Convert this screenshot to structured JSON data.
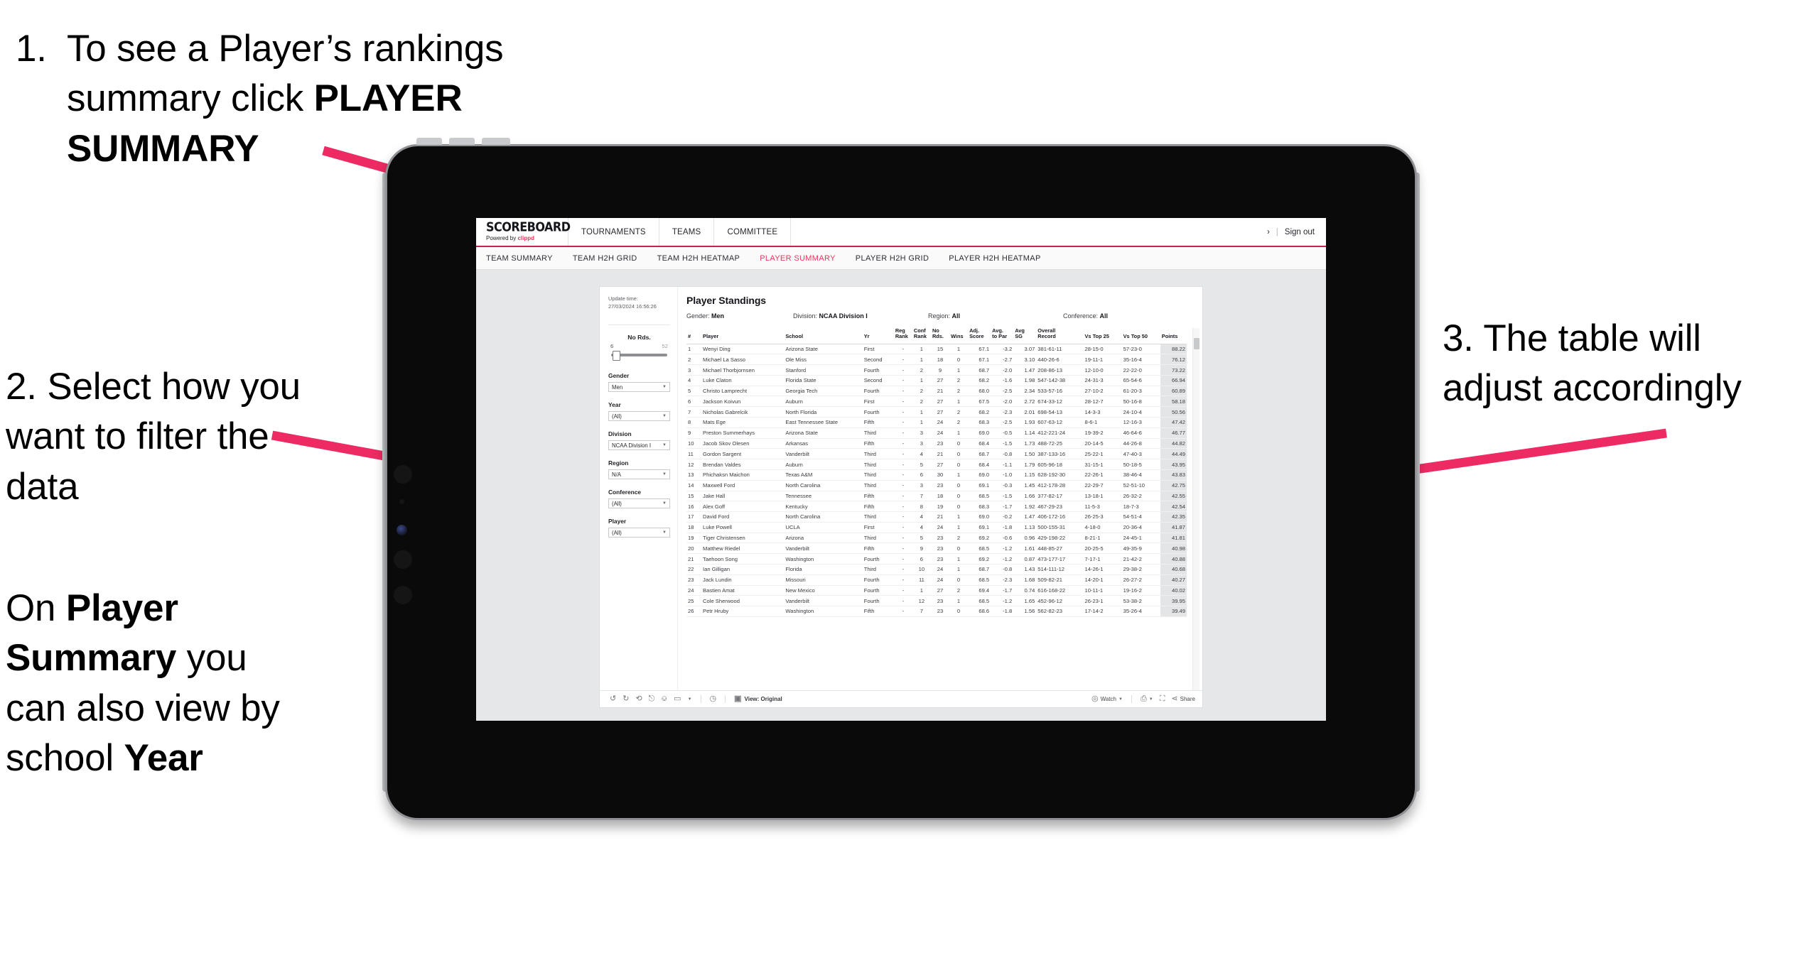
{
  "slide": {
    "callouts": [
      {
        "id": "callout-1",
        "number": "1.",
        "line1_plain": "To see a Player’s",
        "line2_plain": "summary click ",
        "line2_bold": "PLAYER",
        "line3_bold": "SUMMARY"
      },
      {
        "id": "callout-2",
        "text": "2. Select how you want to filter the data"
      },
      {
        "id": "callout-2b",
        "part1": "On ",
        "bold1": "Player Summary",
        "part2": " you can also view by school ",
        "bold2": "Year"
      },
      {
        "id": "callout-3",
        "text": "3. The table will adjust accordingly"
      }
    ],
    "arrow_color": "#ED2B62"
  },
  "app": {
    "brand": {
      "title": "SCOREBOARD",
      "powered_prefix": "Powered by ",
      "powered_name": "clippd"
    },
    "topnav": [
      "TOURNAMENTS",
      "TEAMS",
      "COMMITTEE"
    ],
    "topbar_right": {
      "user_glyph": "›",
      "divider": "|",
      "sign_out": "Sign out"
    },
    "subnav": {
      "items": [
        "TEAM SUMMARY",
        "TEAM H2H GRID",
        "TEAM H2H HEATMAP",
        "PLAYER SUMMARY",
        "PLAYER H2H GRID",
        "PLAYER H2H HEATMAP"
      ],
      "active_index": 3,
      "active_color": "#E8365D"
    },
    "filters": {
      "update_time_label": "Update time:",
      "update_time_value": "27/03/2024 16:56:26",
      "slider": {
        "label": "No Rds.",
        "min": "6",
        "max": "52",
        "thumb_percent": 2
      },
      "selects": [
        {
          "label": "Gender",
          "value": "Men"
        },
        {
          "label": "Year",
          "value": "(All)"
        },
        {
          "label": "Division",
          "value": "NCAA Division I"
        },
        {
          "label": "Region",
          "value": "N/A"
        },
        {
          "label": "Conference",
          "value": "(All)"
        },
        {
          "label": "Player",
          "value": "(All)"
        }
      ]
    },
    "table": {
      "title": "Player Standings",
      "summary": [
        {
          "label": "Gender: ",
          "value": "Men"
        },
        {
          "label": "Division: ",
          "value": "NCAA Division I"
        },
        {
          "label": "Region: ",
          "value": "All"
        },
        {
          "label": "Conference: ",
          "value": "All"
        }
      ],
      "columns": [
        "#",
        "Player",
        "School",
        "Yr",
        "Reg Rank",
        "Conf Rank",
        "No Rds.",
        "Wins",
        "Adj. Score",
        "Avg. to Par",
        "Avg SG",
        "Overall Record",
        "Vs Top 25",
        "Vs Top 50",
        "Points"
      ],
      "columns_wrapped": [
        [
          "#"
        ],
        [
          "Player"
        ],
        [
          "School"
        ],
        [
          "Yr"
        ],
        [
          "Reg",
          "Rank"
        ],
        [
          "Conf",
          "Rank"
        ],
        [
          "No",
          "Rds."
        ],
        [
          "Wins"
        ],
        [
          "Adj.",
          "Score"
        ],
        [
          "Avg.",
          "to Par"
        ],
        [
          "Avg",
          "SG"
        ],
        [
          "Overall",
          "Record"
        ],
        [
          "Vs Top 25"
        ],
        [
          "Vs Top 50"
        ],
        [
          "Points"
        ]
      ],
      "rows": [
        [
          "1",
          "Wenyi Ding",
          "Arizona State",
          "First",
          "-",
          "1",
          "15",
          "1",
          "67.1",
          "-3.2",
          "3.07",
          "381-61-11",
          "28-15-0",
          "57-23-0",
          "88.22"
        ],
        [
          "2",
          "Michael La Sasso",
          "Ole Miss",
          "Second",
          "-",
          "1",
          "18",
          "0",
          "67.1",
          "-2.7",
          "3.10",
          "440-26-6",
          "19-11-1",
          "35-16-4",
          "76.12"
        ],
        [
          "3",
          "Michael Thorbjornsen",
          "Stanford",
          "Fourth",
          "-",
          "2",
          "9",
          "1",
          "68.7",
          "-2.0",
          "1.47",
          "208-86-13",
          "12-10-0",
          "22-22-0",
          "73.22"
        ],
        [
          "4",
          "Luke Claton",
          "Florida State",
          "Second",
          "-",
          "1",
          "27",
          "2",
          "68.2",
          "-1.6",
          "1.98",
          "547-142-38",
          "24-31-3",
          "65-54-6",
          "66.94"
        ],
        [
          "5",
          "Christo Lamprecht",
          "Georgia Tech",
          "Fourth",
          "-",
          "2",
          "21",
          "2",
          "68.0",
          "-2.5",
          "2.34",
          "533-57-16",
          "27-10-2",
          "61-20-3",
          "60.89"
        ],
        [
          "6",
          "Jackson Koivun",
          "Auburn",
          "First",
          "-",
          "2",
          "27",
          "1",
          "67.5",
          "-2.0",
          "2.72",
          "674-33-12",
          "28-12-7",
          "50-16-8",
          "58.18"
        ],
        [
          "7",
          "Nicholas Gabrelcik",
          "North Florida",
          "Fourth",
          "-",
          "1",
          "27",
          "2",
          "68.2",
          "-2.3",
          "2.01",
          "698-54-13",
          "14-3-3",
          "24-10-4",
          "50.56"
        ],
        [
          "8",
          "Mats Ege",
          "East Tennessee State",
          "Fifth",
          "-",
          "1",
          "24",
          "2",
          "68.3",
          "-2.5",
          "1.93",
          "607-63-12",
          "8-6-1",
          "12-16-3",
          "47.42"
        ],
        [
          "9",
          "Preston Summerhays",
          "Arizona State",
          "Third",
          "-",
          "3",
          "24",
          "1",
          "69.0",
          "-0.5",
          "1.14",
          "412-221-24",
          "19-39-2",
          "46-64-6",
          "46.77"
        ],
        [
          "10",
          "Jacob Skov Olesen",
          "Arkansas",
          "Fifth",
          "-",
          "3",
          "23",
          "0",
          "68.4",
          "-1.5",
          "1.73",
          "488-72-25",
          "20-14-5",
          "44-26-8",
          "44.82"
        ],
        [
          "11",
          "Gordon Sargent",
          "Vanderbilt",
          "Third",
          "-",
          "4",
          "21",
          "0",
          "68.7",
          "-0.8",
          "1.50",
          "387-133-16",
          "25-22-1",
          "47-40-3",
          "44.49"
        ],
        [
          "12",
          "Brendan Valdes",
          "Auburn",
          "Third",
          "-",
          "5",
          "27",
          "0",
          "68.4",
          "-1.1",
          "1.79",
          "605-96-18",
          "31-15-1",
          "50-18-5",
          "43.95"
        ],
        [
          "13",
          "Phichaksn Maichon",
          "Texas A&M",
          "Third",
          "-",
          "6",
          "30",
          "1",
          "69.0",
          "-1.0",
          "1.15",
          "628-192-30",
          "22-26-1",
          "38-46-4",
          "43.83"
        ],
        [
          "14",
          "Maxwell Ford",
          "North Carolina",
          "Third",
          "-",
          "3",
          "23",
          "0",
          "69.1",
          "-0.3",
          "1.45",
          "412-178-28",
          "22-29-7",
          "52-51-10",
          "42.75"
        ],
        [
          "15",
          "Jake Hall",
          "Tennessee",
          "Fifth",
          "-",
          "7",
          "18",
          "0",
          "68.5",
          "-1.5",
          "1.66",
          "377-82-17",
          "13-18-1",
          "26-32-2",
          "42.55"
        ],
        [
          "16",
          "Alex Goff",
          "Kentucky",
          "Fifth",
          "-",
          "8",
          "19",
          "0",
          "68.3",
          "-1.7",
          "1.92",
          "467-29-23",
          "11-5-3",
          "18-7-3",
          "42.54"
        ],
        [
          "17",
          "David Ford",
          "North Carolina",
          "Third",
          "-",
          "4",
          "21",
          "1",
          "69.0",
          "-0.2",
          "1.47",
          "406-172-16",
          "26-25-3",
          "54-51-4",
          "42.35"
        ],
        [
          "18",
          "Luke Powell",
          "UCLA",
          "First",
          "-",
          "4",
          "24",
          "1",
          "69.1",
          "-1.8",
          "1.13",
          "500-155-31",
          "4-18-0",
          "20-36-4",
          "41.87"
        ],
        [
          "19",
          "Tiger Christensen",
          "Arizona",
          "Third",
          "-",
          "5",
          "23",
          "2",
          "69.2",
          "-0.6",
          "0.96",
          "429-198-22",
          "8-21-1",
          "24-45-1",
          "41.81"
        ],
        [
          "20",
          "Matthew Riedel",
          "Vanderbilt",
          "Fifth",
          "-",
          "9",
          "23",
          "0",
          "68.5",
          "-1.2",
          "1.61",
          "448-85-27",
          "20-25-5",
          "49-35-9",
          "40.98"
        ],
        [
          "21",
          "Taehoon Song",
          "Washington",
          "Fourth",
          "-",
          "6",
          "23",
          "1",
          "69.2",
          "-1.2",
          "0.87",
          "473-177-17",
          "7-17-1",
          "21-42-2",
          "40.88"
        ],
        [
          "22",
          "Ian Gilligan",
          "Florida",
          "Third",
          "-",
          "10",
          "24",
          "1",
          "68.7",
          "-0.8",
          "1.43",
          "514-111-12",
          "14-26-1",
          "29-38-2",
          "40.68"
        ],
        [
          "23",
          "Jack Lundin",
          "Missouri",
          "Fourth",
          "-",
          "11",
          "24",
          "0",
          "68.5",
          "-2.3",
          "1.68",
          "509-82-21",
          "14-20-1",
          "26-27-2",
          "40.27"
        ],
        [
          "24",
          "Bastien Amat",
          "New Mexico",
          "Fourth",
          "-",
          "1",
          "27",
          "2",
          "69.4",
          "-1.7",
          "0.74",
          "616-168-22",
          "10-11-1",
          "19-16-2",
          "40.02"
        ],
        [
          "25",
          "Cole Sherwood",
          "Vanderbilt",
          "Fourth",
          "-",
          "12",
          "23",
          "1",
          "68.5",
          "-1.2",
          "1.65",
          "452-96-12",
          "26-23-1",
          "53-38-2",
          "39.95"
        ],
        [
          "26",
          "Petr Hruby",
          "Washington",
          "Fifth",
          "-",
          "7",
          "23",
          "0",
          "68.6",
          "-1.8",
          "1.56",
          "562-82-23",
          "17-14-2",
          "35-26-4",
          "39.49"
        ]
      ]
    },
    "toolbar": {
      "left_icons": [
        "undo-icon",
        "redo-icon",
        "revert-icon",
        "refresh-icon",
        "pause-icon",
        "rectangle-select-icon"
      ],
      "view_label": "View: Original",
      "watch_label": "Watch",
      "share_label": "Share"
    }
  }
}
